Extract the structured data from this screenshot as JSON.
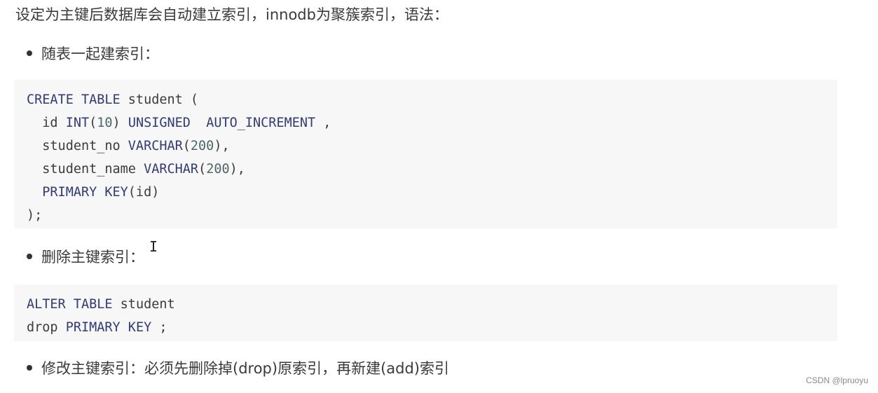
{
  "intro": "设定为主键后数据库会自动建立索引，innodb为聚簇索引，语法：",
  "bullets": [
    "随表一起建索引：",
    "删除主键索引：",
    "修改主键索引：必须先删除掉(drop)原索引，再新建(add)索引"
  ],
  "code_blocks": [
    [
      [
        {
          "t": "CREATE TABLE",
          "c": "kw"
        },
        {
          "t": " student (",
          "c": ""
        }
      ],
      [
        {
          "t": "  id ",
          "c": ""
        },
        {
          "t": "INT",
          "c": "kw"
        },
        {
          "t": "(",
          "c": ""
        },
        {
          "t": "10",
          "c": "num"
        },
        {
          "t": ") ",
          "c": ""
        },
        {
          "t": "UNSIGNED  AUTO_INCREMENT",
          "c": "kw"
        },
        {
          "t": " ,",
          "c": ""
        }
      ],
      [
        {
          "t": "  student_no ",
          "c": ""
        },
        {
          "t": "VARCHAR",
          "c": "kw"
        },
        {
          "t": "(",
          "c": ""
        },
        {
          "t": "200",
          "c": "num"
        },
        {
          "t": "),",
          "c": ""
        }
      ],
      [
        {
          "t": "  student_name ",
          "c": ""
        },
        {
          "t": "VARCHAR",
          "c": "kw"
        },
        {
          "t": "(",
          "c": ""
        },
        {
          "t": "200",
          "c": "num"
        },
        {
          "t": "),",
          "c": ""
        }
      ],
      [
        {
          "t": "  PRIMARY KEY",
          "c": "kw"
        },
        {
          "t": "(id)",
          "c": ""
        }
      ],
      [
        {
          "t": ");",
          "c": ""
        }
      ]
    ],
    [
      [
        {
          "t": "ALTER TABLE",
          "c": "kw"
        },
        {
          "t": " student",
          "c": ""
        }
      ],
      [
        {
          "t": "drop ",
          "c": ""
        },
        {
          "t": "PRIMARY KEY",
          "c": "kw"
        },
        {
          "t": " ;",
          "c": ""
        }
      ]
    ]
  ],
  "watermark": "CSDN @lpruoyu",
  "colors": {
    "keyword": "#333b75",
    "number": "#4d6767",
    "code_bg": "#f7f7f8"
  }
}
